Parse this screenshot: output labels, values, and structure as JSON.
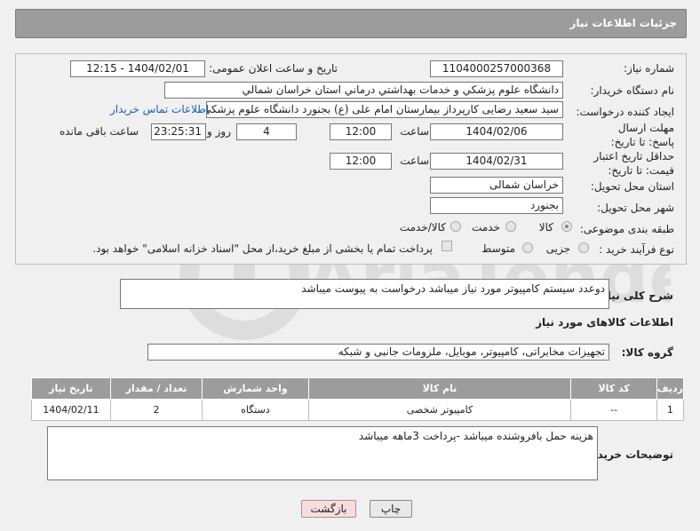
{
  "header": {
    "title": "جزئیات اطلاعات نیاز"
  },
  "form": {
    "need_number_label": "شماره نیاز:",
    "need_number": "1104000257000368",
    "announce_label": "تاریخ و ساعت اعلان عمومی:",
    "announce_value": "1404/02/01 - 12:15",
    "buyer_org_label": "نام دستگاه خریدار:",
    "buyer_org": "دانشگاه علوم پزشکي و خدمات بهداشتي درماني استان خراسان شمالي",
    "creator_label": "ایجاد کننده درخواست:",
    "creator": "سید سعید رضایی کارپرداز بیمارستان امام علی (ع) بجنورد دانشگاه علوم پزشکی",
    "contact_link": "اطلاعات تماس خریدار",
    "deadline_label": "مهلت ارسال پاسخ: تا تاریخ:",
    "deadline_date": "1404/02/06",
    "time_label": "ساعت",
    "deadline_time": "12:00",
    "days_value": "4",
    "days_label": "روز و",
    "remaining_time": "23:25:31",
    "remaining_label": "ساعت باقی مانده",
    "validity_label": "حداقل تاریخ اعتبار قیمت: تا تاریخ:",
    "validity_date": "1404/02/31",
    "validity_time": "12:00",
    "province_label": "استان محل تحویل:",
    "province": "خراسان شمالی",
    "city_label": "شهر محل تحویل:",
    "city": "بجنورد",
    "category_label": "طبقه بندی موضوعی:",
    "category_options": [
      "کالا",
      "خدمت",
      "کالا/خدمت"
    ],
    "process_label": "نوع فرآیند خرید :",
    "process_options": [
      "جزیی",
      "متوسط"
    ],
    "payment_note": "پرداخت تمام یا بخشی از مبلغ خرید،از محل \"اسناد خزانه اسلامی\" خواهد بود."
  },
  "summary": {
    "label": "شرح کلی نیاز:",
    "value": "دوعدد سیستم کامپیوتر مورد نیاز میباشد درخواست به پیوست میباشد"
  },
  "goods": {
    "section_title": "اطلاعات کالاهای مورد نیاز",
    "group_label": "گروه کالا:",
    "group_value": "تجهیزات مخابراتی، کامپیوتر، موبایل، ملزومات جانبی و شبکه",
    "columns": [
      "ردیف",
      "کد کالا",
      "نام کالا",
      "واحد شمارش",
      "تعداد / مقدار",
      "تاریخ نیاز"
    ],
    "rows": [
      [
        "1",
        "--",
        "کامپیوتر شخصی",
        "دستگاه",
        "2",
        "1404/02/11"
      ]
    ]
  },
  "buyer_notes": {
    "label": "توضیحات خریدار:",
    "value": "هزینه حمل بافروشنده میباشد -پرداخت 3ماهه میباشد"
  },
  "buttons": {
    "print": "چاپ",
    "back": "بازگشت"
  },
  "watermark": {
    "text": "AriaTender.net"
  }
}
